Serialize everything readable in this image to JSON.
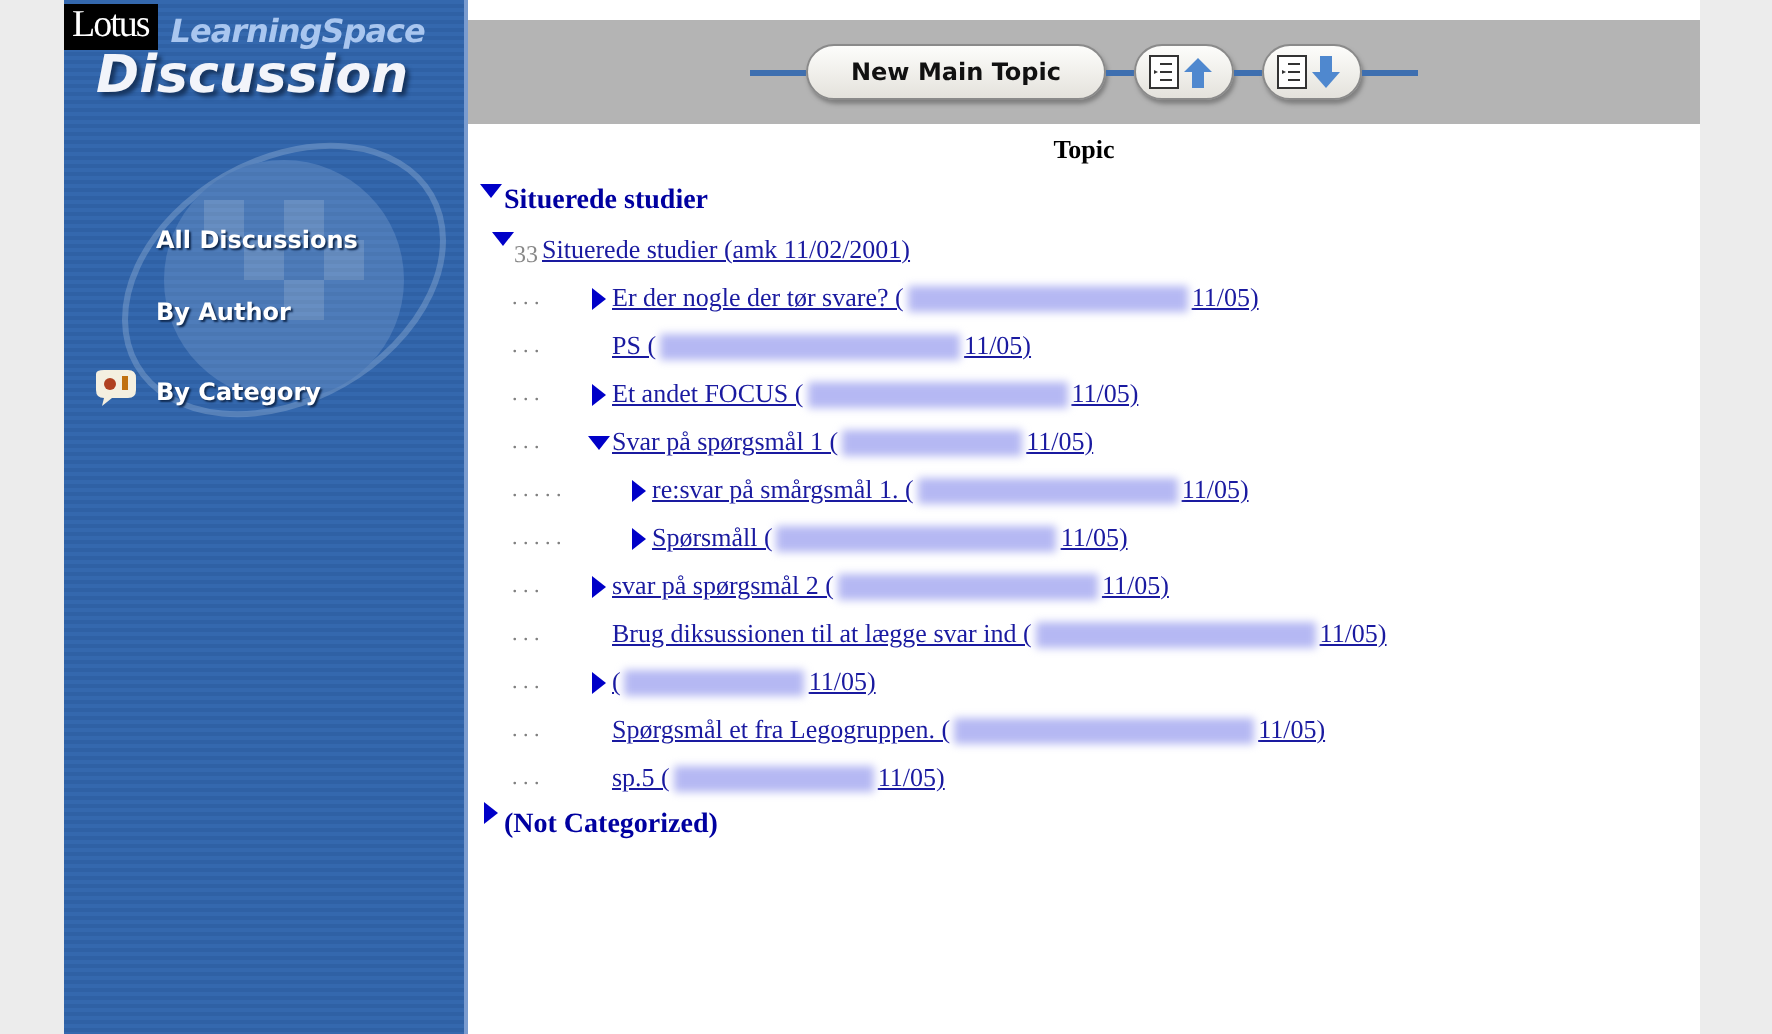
{
  "sidebar": {
    "logo": {
      "brand": "Lotus",
      "product": "LearningSpace",
      "title": "Discussion"
    },
    "items": [
      {
        "label": "All Discussions",
        "selected": false
      },
      {
        "label": "By Author",
        "selected": false
      },
      {
        "label": "By Category",
        "selected": true
      }
    ]
  },
  "toolbar": {
    "buttons": [
      {
        "kind": "text",
        "label": "New Main Topic"
      },
      {
        "kind": "collapse"
      },
      {
        "kind": "expand"
      }
    ]
  },
  "view": {
    "column_header": "Topic",
    "categories": [
      {
        "title": "Situerede studier",
        "expanded": true,
        "topics": [
          {
            "count": "33",
            "title": "Situerede studier (amk 11/02/2001)",
            "expanded": true,
            "children": [
              {
                "leader": ". . .",
                "title": "Er der nogle der tør svare? (",
                "author_redacted": true,
                "date": "11/05)",
                "expanded": false
              },
              {
                "leader": ". . .",
                "title": "PS (",
                "author_redacted": true,
                "date": "11/05)"
              },
              {
                "leader": ". . .",
                "title": "Et andet FOCUS (",
                "author_redacted": true,
                "date": "11/05)",
                "expanded": false
              },
              {
                "leader": ". . .",
                "title": "Svar på spørgsmål 1 (",
                "author_redacted": true,
                "date": "11/05)",
                "expanded": true,
                "children": [
                  {
                    "leader": ". . . . .",
                    "title": "re:svar på smårgsmål 1. (",
                    "author_redacted": true,
                    "date": "11/05)",
                    "expanded": false
                  },
                  {
                    "leader": ". . . . .",
                    "title": "Spørsmåll (",
                    "author_redacted": true,
                    "date": "11/05)",
                    "expanded": false
                  }
                ]
              },
              {
                "leader": ". . .",
                "title": "svar på spørgsmål 2 (",
                "author_redacted": true,
                "date": "11/05)",
                "expanded": false
              },
              {
                "leader": ". . .",
                "title": "Brug diksussionen til at lægge svar ind (",
                "author_redacted": true,
                "date": "11/05)"
              },
              {
                "leader": ". . .",
                "title": "(",
                "author_redacted": true,
                "date": "11/05)",
                "expanded": false
              },
              {
                "leader": ". . .",
                "title": "Spørgsmål et fra Legogruppen. (",
                "author_redacted": true,
                "date": "11/05)"
              },
              {
                "leader": ". . .",
                "title": "sp.5 (",
                "author_redacted": true,
                "date": "11/05)"
              }
            ]
          }
        ]
      },
      {
        "title": "(Not Categorized)",
        "expanded": false
      }
    ]
  }
}
